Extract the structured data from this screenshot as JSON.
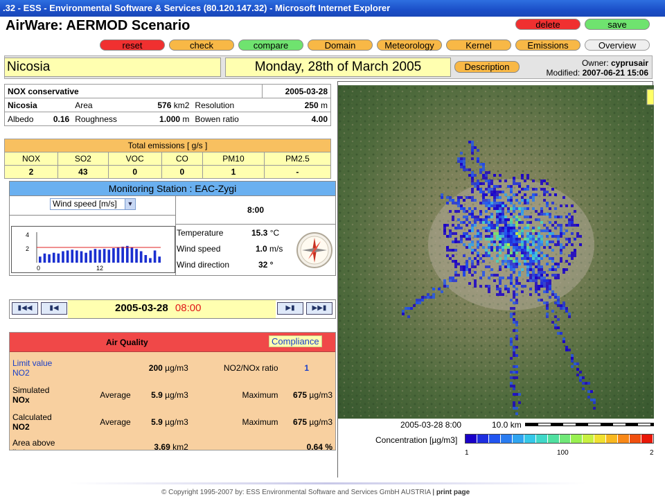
{
  "browser": {
    "title": ".32 - ESS - Environmental Software & Services (80.120.147.32) - Microsoft Internet Explorer"
  },
  "app": {
    "title": "AirWare: AERMOD Scenario"
  },
  "top_buttons": {
    "delete": "delete",
    "save": "save"
  },
  "nav": {
    "reset": "reset",
    "check": "check",
    "compare": "compare",
    "domain": "Domain",
    "meteorology": "Meteorology",
    "kernel": "Kernel",
    "emissions": "Emissions",
    "overview": "Overview"
  },
  "header": {
    "city": "Nicosia",
    "date": "Monday, 28th of March 2005",
    "description": "Description",
    "owner_label": "Owner:",
    "owner": "cyprusair",
    "modified_label": "Modified:",
    "modified": "2007-06-21 15:06"
  },
  "scenario": {
    "name": "NOX conservative",
    "date": "2005-03-28",
    "domain": "Nicosia",
    "area_label": "Area",
    "area": "576",
    "area_unit": "km2",
    "resolution_label": "Resolution",
    "resolution": "250",
    "resolution_unit": "m",
    "albedo_label": "Albedo",
    "albedo": "0.16",
    "roughness_label": "Roughness",
    "roughness": "1.000",
    "roughness_unit": "m",
    "bowen_label": "Bowen ratio",
    "bowen": "4.00"
  },
  "emissions": {
    "title": "Total emissions [ g/s ]",
    "headers": [
      "NOX",
      "SO2",
      "VOC",
      "CO",
      "PM10",
      "PM2.5"
    ],
    "values": [
      "2",
      "43",
      "0",
      "0",
      "1",
      "-"
    ]
  },
  "station": {
    "title": "Monitoring Station : EAC-Zygi",
    "select_value": "Wind speed [m/s]",
    "time": "8:00",
    "temp_label": "Temperature",
    "temp": "15.3",
    "temp_unit": "°C",
    "wind_label": "Wind speed",
    "wind": "1.0",
    "wind_unit": "m/s",
    "dir_label": "Wind direction",
    "dir": "32 °"
  },
  "chart_data": {
    "type": "bar",
    "y_ticks": [
      "4",
      "2"
    ],
    "x_ticks": [
      "0",
      "12"
    ],
    "ylim": [
      0,
      4
    ],
    "threshold": 2,
    "values": [
      0.8,
      1.2,
      1.1,
      1.3,
      1.2,
      1.5,
      1.6,
      1.7,
      1.6,
      1.5,
      1.3,
      1.6,
      1.8,
      1.7,
      1.8,
      1.7,
      1.9,
      2.0,
      2.1,
      2.2,
      2.0,
      1.8,
      1.5,
      1.0,
      0.6,
      1.6,
      0.8
    ]
  },
  "timeline": {
    "date": "2005-03-28",
    "time": "08:00"
  },
  "air_quality": {
    "title": "Air Quality",
    "compliance": "Compliance",
    "limit_label1": "Limit value",
    "limit_label2": "NO2",
    "limit_value": "200",
    "limit_unit": "µg/m3",
    "ratio_label": "NO2/NOx ratio",
    "ratio": "1",
    "sim_label1": "Simulated",
    "sim_label2": "NOx",
    "sim_avg_label": "Average",
    "sim_avg": "5.9",
    "sim_avg_unit": "µg/m3",
    "sim_max_label": "Maximum",
    "sim_max": "675",
    "sim_max_unit": "µg/m3",
    "calc_label1": "Calculated",
    "calc_label2": "NO2",
    "calc_avg_label": "Average",
    "calc_avg": "5.9",
    "calc_avg_unit": "µg/m3",
    "calc_max_label": "Maximum",
    "calc_max": "675",
    "calc_max_unit": "µg/m3",
    "area_label1": "Area above",
    "area_label2": "limit",
    "area": "3.69",
    "area_unit": "km2",
    "pct": "0.64",
    "pct_unit": "%"
  },
  "map": {
    "timestamp": "2005-03-28 8:00",
    "scale": "10.0 km",
    "legend_label": "Concentration [µg/m3]",
    "legend_ticks": [
      "1",
      "100",
      "2"
    ],
    "legend_colors": [
      "#1a00c8",
      "#1e2ee0",
      "#2255f0",
      "#2a7cf0",
      "#30a5f0",
      "#35c8e8",
      "#40d8c8",
      "#50e0a0",
      "#70e878",
      "#98f050",
      "#c8f040",
      "#f0e030",
      "#f8b820",
      "#f88818",
      "#f05010",
      "#e81808"
    ]
  },
  "footer": {
    "copyright": "© Copyright 1995-2007 by:  ESS  Environmental Software and Services GmbH AUSTRIA",
    "print": "print page"
  }
}
